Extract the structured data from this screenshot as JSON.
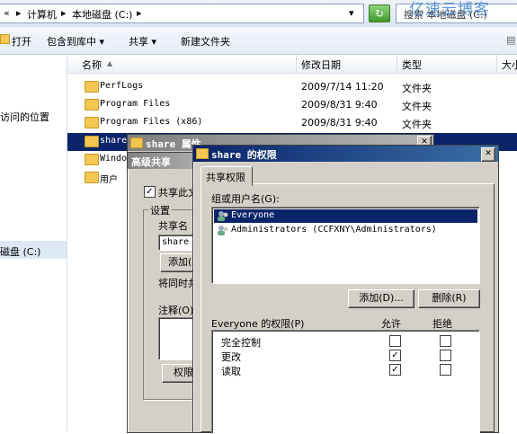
{
  "address": {
    "path_sep1": "«",
    "computer": "计算机",
    "sep": "▸",
    "disk": "本地磁盘 (C:)",
    "dropdown": "▾",
    "refresh_glyph": "↻",
    "search_placeholder": "搜索 本地磁盘 (C:)"
  },
  "watermark": "亿速云博客",
  "toolbar": {
    "open": "打开",
    "include_library": "包含到库中 ▾",
    "share": "共享 ▾",
    "new_folder": "新建文件夹"
  },
  "nav": {
    "recent_places": "访问的位置",
    "local_disk": "磁盘 (C:)"
  },
  "columns": {
    "name": "名称",
    "sort": "▲",
    "modified": "修改日期",
    "type": "类型",
    "size": "大小"
  },
  "files": [
    {
      "name": "PerfLogs",
      "date": "2009/7/14 11:20",
      "type": "文件夹"
    },
    {
      "name": "Program Files",
      "date": "2009/8/31 9:40",
      "type": "文件夹"
    },
    {
      "name": "Program Files (x86)",
      "date": "2009/8/31 9:40",
      "type": "文件夹"
    },
    {
      "name": "share",
      "date": "",
      "type": ""
    },
    {
      "name": "Windo",
      "date": "",
      "type": ""
    },
    {
      "name": "用户",
      "date": "",
      "type": ""
    }
  ],
  "props_dialog": {
    "title": "share 属性"
  },
  "adv_dialog": {
    "title": "高级共享",
    "share_checkbox": "共享此文件夹",
    "settings": "设置",
    "share_name_label": "共享名",
    "share_name_value": "share",
    "add_button": "添加(",
    "limit_label": "将同时共",
    "comment_label": "注释(O)",
    "perm_button": "权限"
  },
  "perm_dialog": {
    "title": "share 的权限",
    "close": "✕",
    "tab": "共享权限",
    "group_label": "组或用户名(G):",
    "users": [
      "Everyone",
      "Administrators (CCFXNY\\Administrators)"
    ],
    "add_button": "添加(D)...",
    "remove_button": "删除(R)",
    "perm_label": "Everyone 的权限(P)",
    "allow": "允许",
    "deny": "拒绝",
    "permissions": [
      {
        "name": "完全控制",
        "allow": false,
        "deny": false
      },
      {
        "name": "更改",
        "allow": true,
        "deny": false
      },
      {
        "name": "读取",
        "allow": true,
        "deny": false
      }
    ]
  },
  "colors": {
    "selection": "#0a246a",
    "title_active": "#0a246a",
    "title_inactive": "#808080",
    "dialog_face": "#d4d0c8"
  }
}
